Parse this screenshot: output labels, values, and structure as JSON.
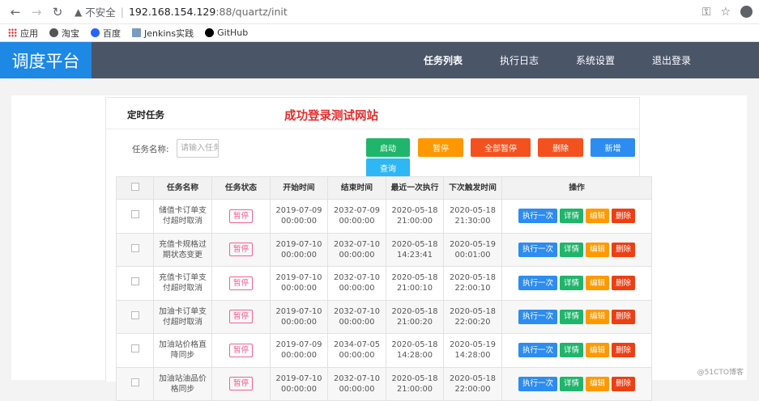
{
  "browser": {
    "insecure_text": "不安全",
    "host": "192.168.154.129",
    "path": ":88/quartz/init",
    "bookmarks": [
      {
        "label": "应用",
        "icon": "apps-grid-icon",
        "color": "#e53935"
      },
      {
        "label": "淘宝",
        "icon": "globe-icon",
        "color": "#555555"
      },
      {
        "label": "百度",
        "icon": "paw-icon",
        "color": "#2962ff"
      },
      {
        "label": "Jenkins实践",
        "icon": "page-icon",
        "color": "#7a9bbd"
      },
      {
        "label": "GitHub",
        "icon": "github-icon",
        "color": "#000000"
      }
    ]
  },
  "app": {
    "logo": "调度平台",
    "nav": [
      {
        "label": "任务列表",
        "active": true
      },
      {
        "label": "执行日志",
        "active": false
      },
      {
        "label": "系统设置",
        "active": false
      },
      {
        "label": "退出登录",
        "active": false
      }
    ]
  },
  "panel": {
    "title": "定时任务",
    "banner": "成功登录测试网站",
    "search_label": "任务名称:",
    "search_placeholder": "请输入任务",
    "buttons": {
      "start": "启动",
      "pause": "暂停",
      "pause_all": "全部暂停",
      "delete": "删除",
      "add": "新增",
      "query": "查询"
    }
  },
  "table": {
    "headers": [
      "任务名称",
      "任务状态",
      "开始时间",
      "结束时间",
      "最近一次执行",
      "下次触发时间",
      "操作"
    ],
    "rows": [
      {
        "name": "储值卡订单支付超时取消",
        "status": "暂停",
        "start": "2019-07-09 00:00:00",
        "end": "2032-07-09 00:00:00",
        "last": "2020-05-18 21:00:00",
        "next": "2020-05-18 21:30:00"
      },
      {
        "name": "充值卡规格过期状态变更",
        "status": "暂停",
        "start": "2019-07-10 00:00:00",
        "end": "2032-07-10 00:00:00",
        "last": "2020-05-18 14:23:41",
        "next": "2020-05-19 00:01:00"
      },
      {
        "name": "充值卡订单支付超时取消",
        "status": "暂停",
        "start": "2019-07-10 00:00:00",
        "end": "2032-07-10 00:00:00",
        "last": "2020-05-18 21:00:10",
        "next": "2020-05-18 22:00:10"
      },
      {
        "name": "加油卡订单支付超时取消",
        "status": "暂停",
        "start": "2019-07-10 00:00:00",
        "end": "2032-07-10 00:00:00",
        "last": "2020-05-18 21:00:20",
        "next": "2020-05-18 22:00:20"
      },
      {
        "name": "加油站价格直降同步",
        "status": "暂停",
        "start": "2019-07-09 00:00:00",
        "end": "2034-07-05 00:00:00",
        "last": "2020-05-18 14:28:00",
        "next": "2020-05-19 14:28:00"
      },
      {
        "name": "加油站油品价格同步",
        "status": "暂停",
        "start": "2019-07-10 00:00:00",
        "end": "2032-07-10 00:00:00",
        "last": "2020-05-18 21:00:00",
        "next": "2020-05-18 22:00:00"
      }
    ],
    "ops": {
      "run_once": "执行一次",
      "detail": "详情",
      "edit": "编辑",
      "delete": "删除"
    }
  },
  "watermark": "@51CTO博客",
  "colors": {
    "green": "#1fb56b",
    "orange": "#ff9800",
    "red": "#f4511e",
    "blue": "#2d8cf0",
    "cyan": "#2db7f5",
    "edit": "#ff9900",
    "del": "#ed3f14"
  }
}
